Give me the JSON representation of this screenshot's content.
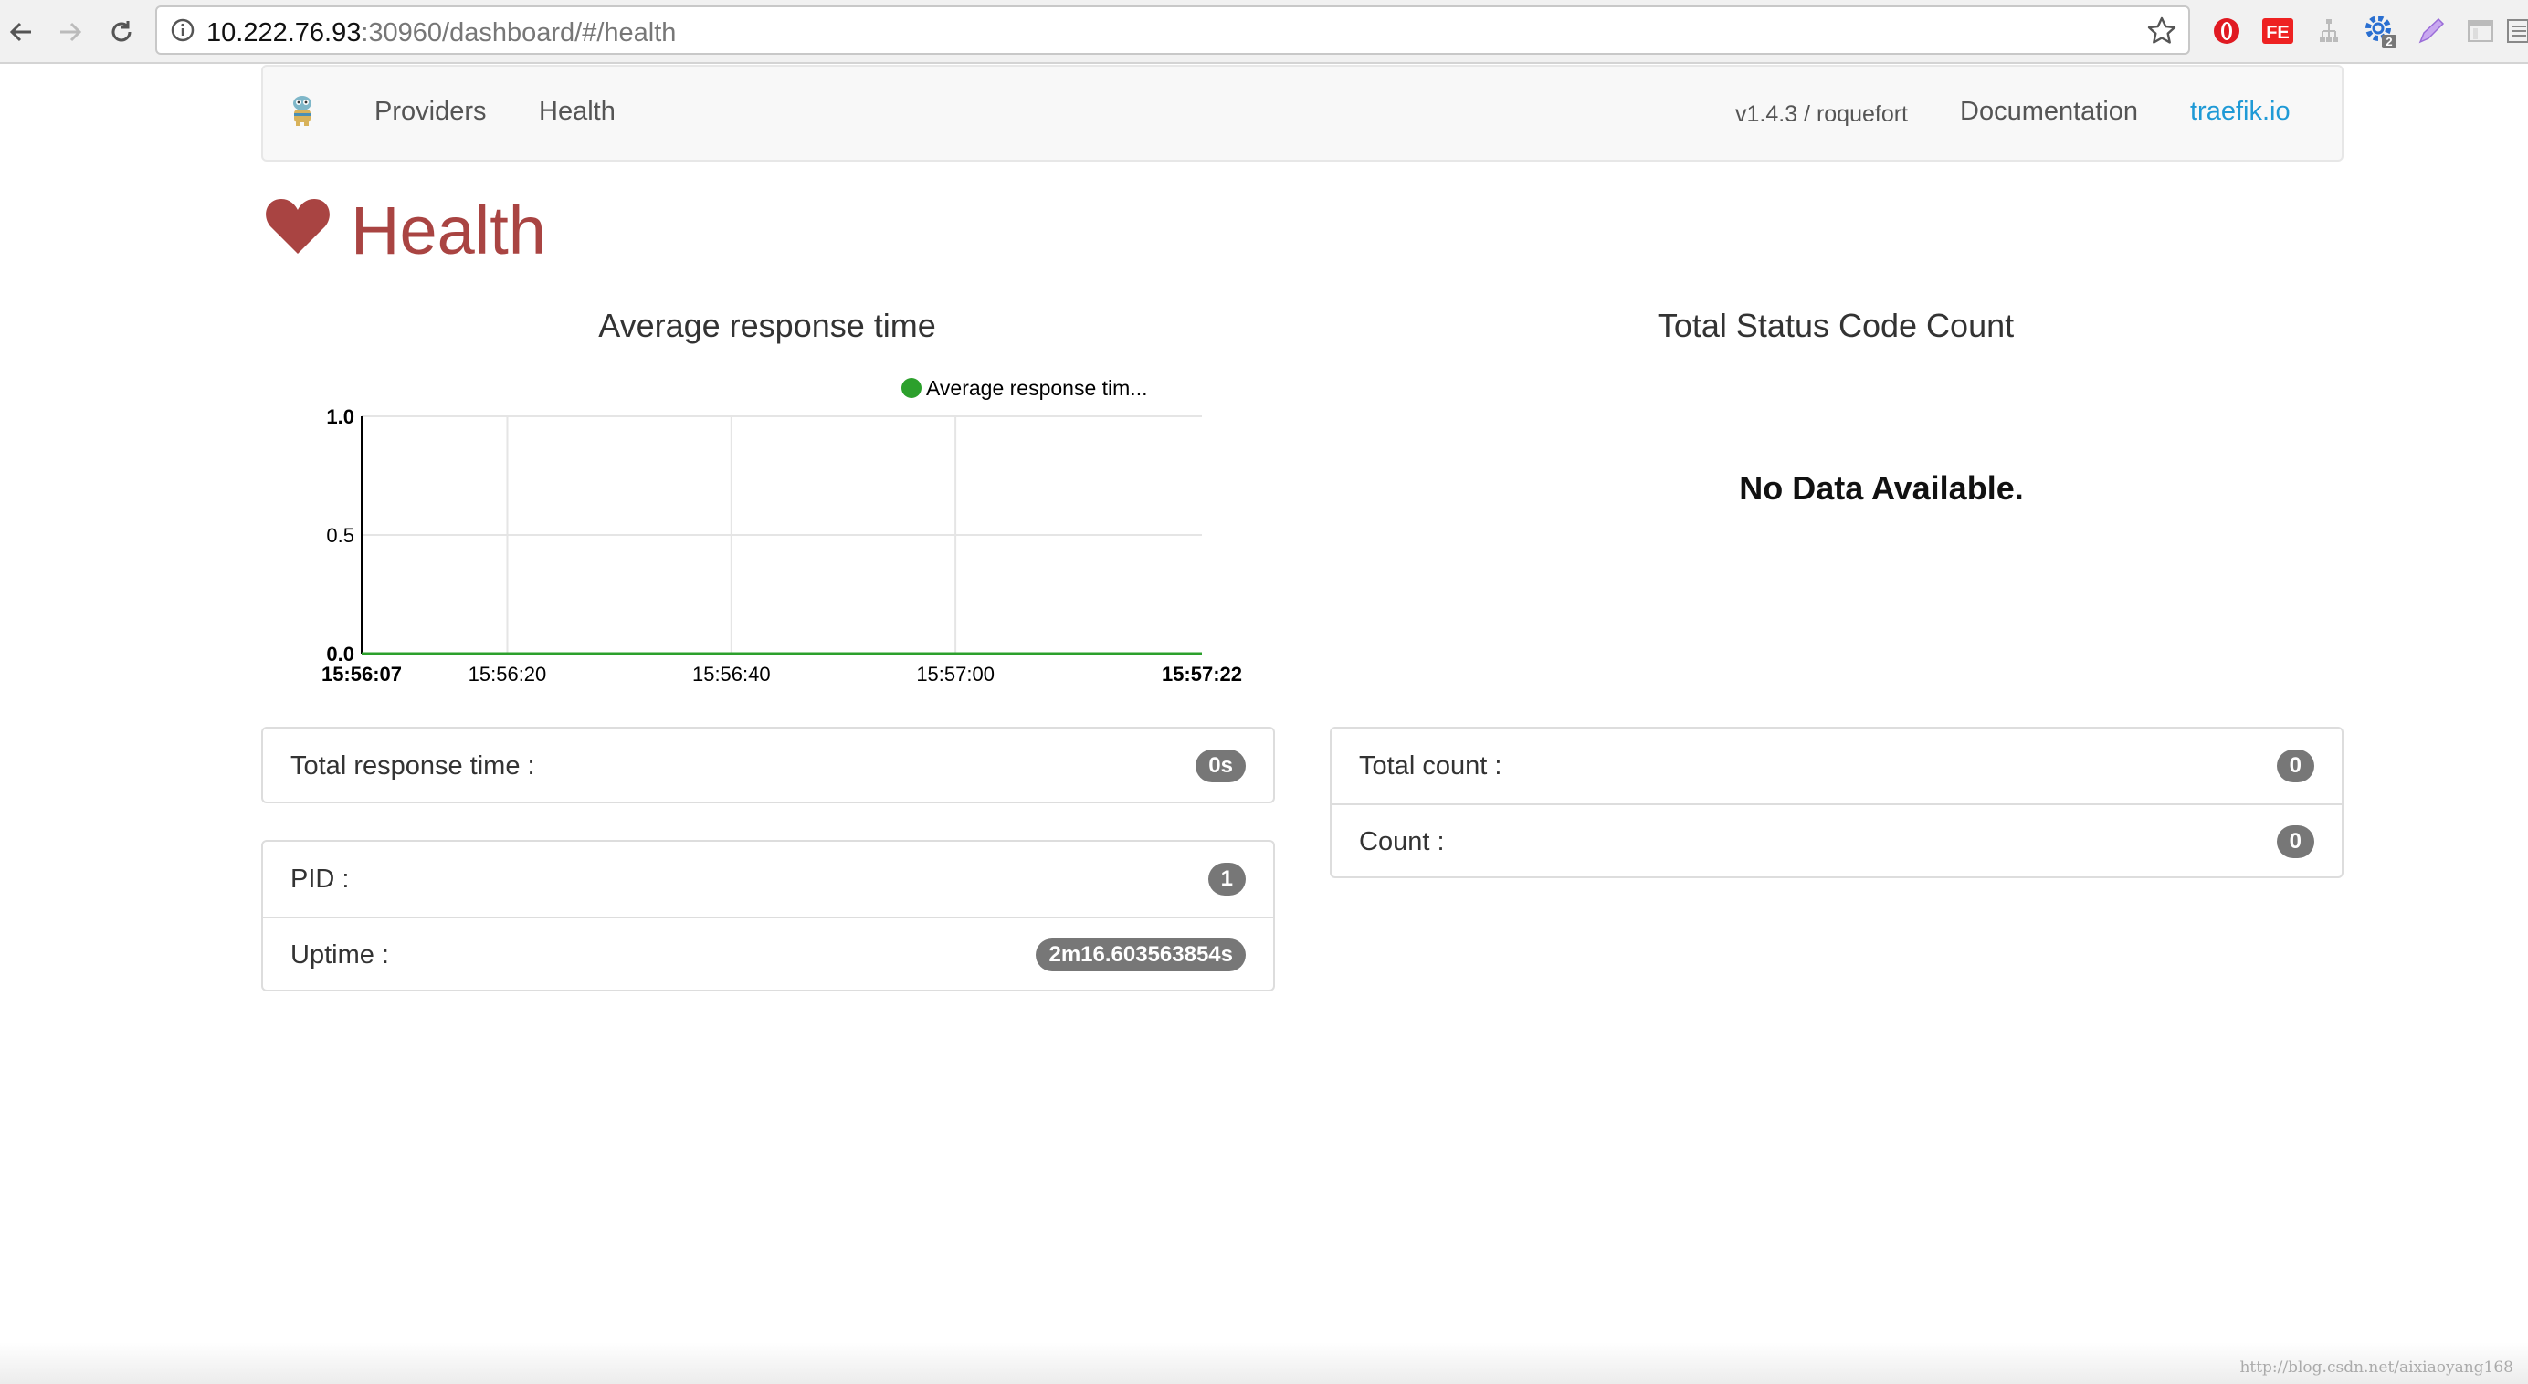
{
  "browser": {
    "url_host": "10.222.76.93",
    "url_rest": ":30960/dashboard/#/health",
    "icons": [
      "back-icon",
      "forward-icon",
      "reload-icon",
      "info-icon",
      "star-icon"
    ],
    "extensions": [
      "opera-extension-icon",
      "fe-extension-icon",
      "network-extension-icon",
      "gear-extension-icon",
      "pen-extension-icon",
      "panel-extension-icon"
    ],
    "gear_badge": "2"
  },
  "navbar": {
    "logo": "traefik-logo-icon",
    "providers_label": "Providers",
    "health_label": "Health",
    "version_label": "v1.4.3 / roquefort",
    "documentation_label": "Documentation",
    "traefik_link_label": "traefik.io",
    "accent_color": "#1f9ad6"
  },
  "page": {
    "title": "Health",
    "title_icon": "heart-icon",
    "title_color": "#a94442"
  },
  "left_chart": {
    "title": "Average response time",
    "legend_label": "Average response tim...",
    "legend_color": "#2ca02c"
  },
  "right_chart": {
    "title": "Total Status Code Count",
    "empty_message": "No Data Available."
  },
  "chart_data": {
    "type": "line",
    "title": "Average response time",
    "xlabel": "",
    "ylabel": "",
    "x_tick_labels": [
      "15:56:07",
      "15:56:20",
      "15:56:40",
      "15:57:00",
      "15:57:22"
    ],
    "y_tick_labels": [
      "1.0",
      "0.5",
      "0.0"
    ],
    "ylim": [
      0,
      1
    ],
    "grid": true,
    "legend_position": "top-right",
    "series": [
      {
        "name": "Average response tim...",
        "color": "#2ca02c",
        "x": [
          "15:56:07",
          "15:57:22"
        ],
        "y": [
          0,
          0
        ]
      }
    ]
  },
  "response_panel": {
    "total_response_time_label": "Total response time :",
    "total_response_time_value": "0s"
  },
  "process_panel": {
    "pid_label": "PID :",
    "pid_value": "1",
    "uptime_label": "Uptime :",
    "uptime_value": "2m16.603563854s"
  },
  "count_panel": {
    "total_count_label": "Total count :",
    "total_count_value": "0",
    "count_label": "Count :",
    "count_value": "0"
  },
  "watermark": "http://blog.csdn.net/aixiaoyang168"
}
